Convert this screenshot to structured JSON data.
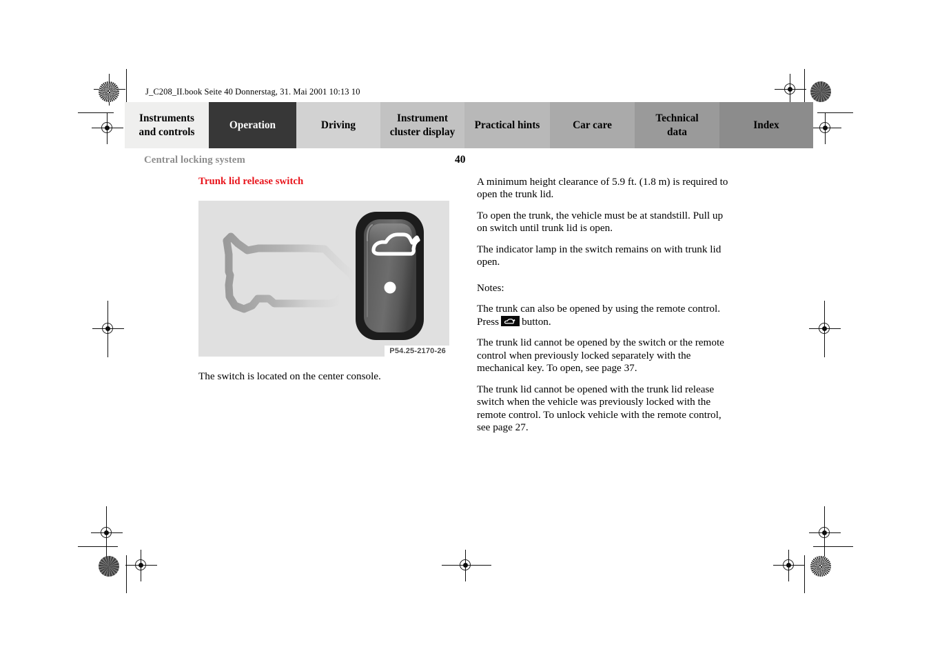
{
  "document": {
    "file_info": "J_C208_II.book  Seite 40  Donnerstag, 31. Mai 2001  10:13 10",
    "running_head": "Central locking system",
    "page_number": "40"
  },
  "tabs": [
    {
      "label": "Instruments and controls",
      "line1": "Instruments",
      "line2": "and controls",
      "color": "#efefee",
      "active": false
    },
    {
      "label": "Operation",
      "line1": "Operation",
      "line2": "",
      "color": "#373737",
      "active": true
    },
    {
      "label": "Driving",
      "line1": "Driving",
      "line2": "",
      "color": "#d2d2d2",
      "active": false
    },
    {
      "label": "Instrument cluster display",
      "line1": "Instrument",
      "line2": "cluster display",
      "color": "#c2c2c2",
      "active": false
    },
    {
      "label": "Practical hints",
      "line1": "Practical hints",
      "line2": "",
      "color": "#b8b8b8",
      "active": false
    },
    {
      "label": "Car care",
      "line1": "Car care",
      "line2": "",
      "color": "#aaaaaa",
      "active": false
    },
    {
      "label": "Technical data",
      "line1": "Technical",
      "line2": "data",
      "color": "#9a9a9a",
      "active": false
    },
    {
      "label": "Index",
      "line1": "Index",
      "line2": "",
      "color": "#8c8c8c",
      "active": false
    }
  ],
  "left_column": {
    "section_title": "Trunk lid release switch",
    "figure_caption": "P54.25-2170-26",
    "figure_note": "The switch is located on the center console."
  },
  "right_column": {
    "paragraph_1": "A minimum height clearance of 5.9 ft. (1.8 m) is required to open the trunk lid.",
    "paragraph_2": "To open the trunk, the vehicle must be at standstill. Pull up on switch until trunk lid is open.",
    "paragraph_3": "The indicator lamp in the switch remains on with trunk lid open.",
    "notes_label": "Notes:",
    "note_1_part_a": "The trunk can also be opened by using the remote control. Press",
    "note_1_part_b": "button.",
    "note_2": "The trunk lid cannot be opened by the switch or the remote control when previously locked separately with the mechanical key. To open, see page 37.",
    "note_3": "The trunk lid cannot be opened with the trunk lid release switch when the vehicle was previously locked with the remote control. To unlock vehicle with the remote control, see page 27."
  },
  "colors": {
    "section_title_red": "#e8141b",
    "running_head_gray": "#8d8d8d",
    "figure_background": "#e0e0e0",
    "active_tab": "#373737"
  }
}
